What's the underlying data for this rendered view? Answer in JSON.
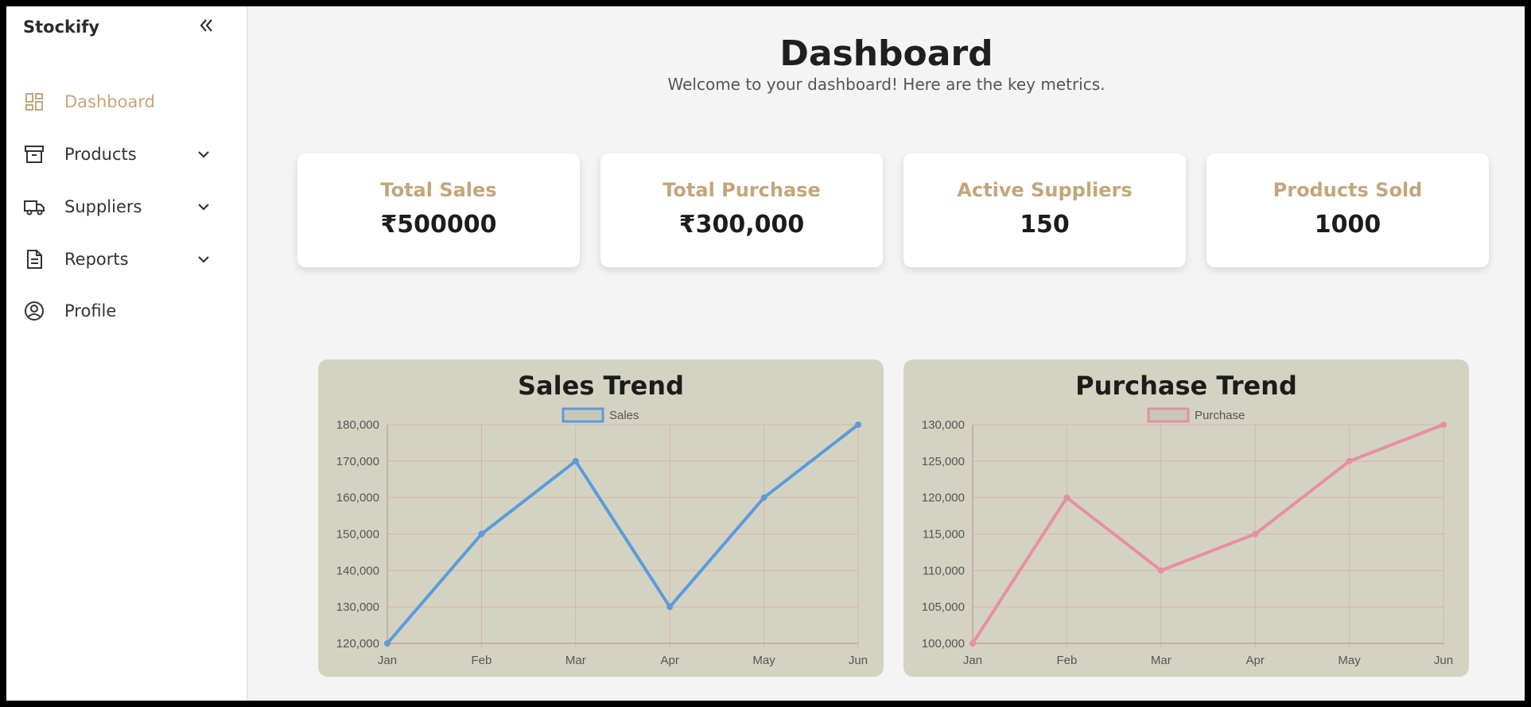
{
  "sidebar": {
    "brand": "Stockify",
    "items": [
      {
        "label": "Dashboard",
        "icon": "dashboard-icon",
        "active": true
      },
      {
        "label": "Products",
        "icon": "archive-box-icon",
        "expandable": true
      },
      {
        "label": "Suppliers",
        "icon": "truck-icon",
        "expandable": true
      },
      {
        "label": "Reports",
        "icon": "document-icon",
        "expandable": true
      },
      {
        "label": "Profile",
        "icon": "user-circle-icon"
      }
    ]
  },
  "header": {
    "title": "Dashboard",
    "subtitle": "Welcome to your dashboard! Here are the key metrics."
  },
  "metrics": [
    {
      "label": "Total Sales",
      "value": "₹500000"
    },
    {
      "label": "Total Purchase",
      "value": "₹300,000"
    },
    {
      "label": "Active Suppliers",
      "value": "150"
    },
    {
      "label": "Products Sold",
      "value": "1000"
    }
  ],
  "colors": {
    "accent": "#c4a57a",
    "panel": "#d4d3c2",
    "sales_line": "#5b9bdc",
    "purchase_line": "#e88fa0"
  },
  "chart_data": [
    {
      "type": "line",
      "title": "Sales Trend",
      "categories": [
        "Jan",
        "Feb",
        "Mar",
        "Apr",
        "May",
        "Jun"
      ],
      "series": [
        {
          "name": "Sales",
          "values": [
            120000,
            150000,
            170000,
            130000,
            160000,
            180000
          ]
        }
      ],
      "ylim": [
        120000,
        180000
      ],
      "yticks": [
        "180,000",
        "170,000",
        "160,000",
        "150,000",
        "140,000",
        "130,000",
        "120,000"
      ],
      "grid": true,
      "legend": "top-center",
      "color": "#5b9bdc"
    },
    {
      "type": "line",
      "title": "Purchase Trend",
      "categories": [
        "Jan",
        "Feb",
        "Mar",
        "Apr",
        "May",
        "Jun"
      ],
      "series": [
        {
          "name": "Purchase",
          "values": [
            100000,
            120000,
            110000,
            115000,
            125000,
            130000
          ]
        }
      ],
      "ylim": [
        100000,
        130000
      ],
      "yticks": [
        "130,000",
        "125,000",
        "120,000",
        "115,000",
        "110,000",
        "105,000",
        "100,000"
      ],
      "grid": true,
      "legend": "top-center",
      "color": "#e88fa0"
    }
  ]
}
